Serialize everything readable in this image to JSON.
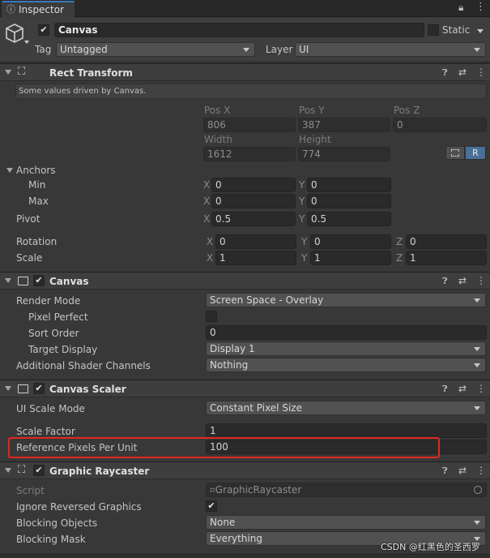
{
  "tab": {
    "title": "Inspector"
  },
  "object": {
    "name": "Canvas",
    "active": true,
    "static_label": "Static",
    "static_checked": false,
    "tag_label": "Tag",
    "tag_value": "Untagged",
    "layer_label": "Layer",
    "layer_value": "UI"
  },
  "rect_transform": {
    "title": "Rect Transform",
    "note": "Some values driven by Canvas.",
    "pos_x_label": "Pos X",
    "pos_y_label": "Pos Y",
    "pos_z_label": "Pos Z",
    "pos_x": "806",
    "pos_y": "387",
    "pos_z": "0",
    "width_label": "Width",
    "height_label": "Height",
    "width": "1612",
    "height": "774",
    "r_button": "R",
    "anchors_label": "Anchors",
    "min_label": "Min",
    "max_label": "Max",
    "min_x": "0",
    "min_y": "0",
    "max_x": "0",
    "max_y": "0",
    "pivot_label": "Pivot",
    "pivot_x": "0.5",
    "pivot_y": "0.5",
    "rotation_label": "Rotation",
    "rot_x": "0",
    "rot_y": "0",
    "rot_z": "0",
    "scale_label": "Scale",
    "scale_x": "1",
    "scale_y": "1",
    "scale_z": "1",
    "x_axis": "X",
    "y_axis": "Y",
    "z_axis": "Z"
  },
  "canvas": {
    "title": "Canvas",
    "enabled": true,
    "render_mode_label": "Render Mode",
    "render_mode": "Screen Space - Overlay",
    "pixel_perfect_label": "Pixel Perfect",
    "pixel_perfect": false,
    "sort_order_label": "Sort Order",
    "sort_order": "0",
    "target_display_label": "Target Display",
    "target_display": "Display 1",
    "shader_channels_label": "Additional Shader Channels",
    "shader_channels": "Nothing"
  },
  "canvas_scaler": {
    "title": "Canvas Scaler",
    "enabled": true,
    "ui_scale_mode_label": "UI Scale Mode",
    "ui_scale_mode": "Constant Pixel Size",
    "scale_factor_label": "Scale Factor",
    "scale_factor": "1",
    "ref_pixels_label": "Reference Pixels Per Unit",
    "ref_pixels": "100"
  },
  "graphic_raycaster": {
    "title": "Graphic Raycaster",
    "enabled": true,
    "script_label": "Script",
    "script_value": "GraphicRaycaster",
    "ignore_reversed_label": "Ignore Reversed Graphics",
    "ignore_reversed": true,
    "blocking_objects_label": "Blocking Objects",
    "blocking_objects": "None",
    "blocking_mask_label": "Blocking Mask",
    "blocking_mask": "Everything"
  },
  "watermark": "CSDN @红黑色的圣西罗",
  "colors": {
    "highlight_box": "#e0281e",
    "selected_r": "#4a6f98"
  }
}
